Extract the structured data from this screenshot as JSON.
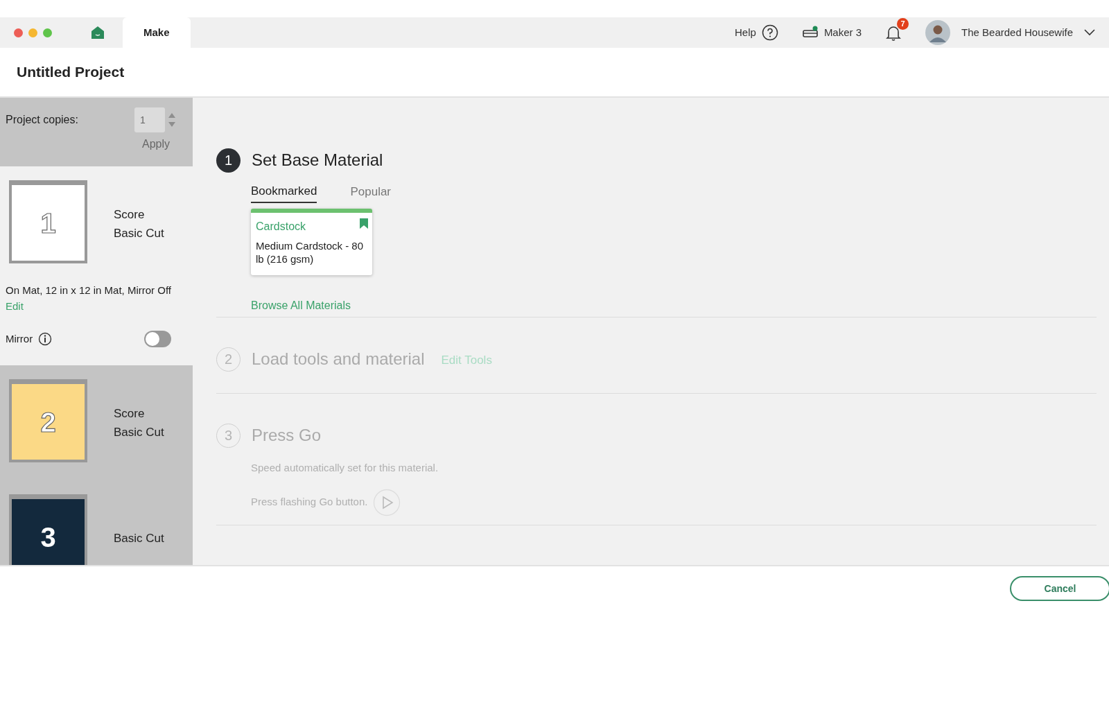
{
  "tabs": [
    {
      "kind": "home",
      "selected": false
    },
    {
      "kind": "text",
      "label": "Make",
      "selected": true
    }
  ],
  "top_bar": {
    "help": "Help",
    "machine": "Maker 3",
    "machine_connected": true,
    "notifications": "7",
    "user": "The Bearded Housewife"
  },
  "project": {
    "title": "Untitled Project"
  },
  "copies": {
    "label": "Project copies:",
    "value": "1",
    "button": "Apply",
    "disabled": true
  },
  "mats": [
    {
      "number": "1",
      "color": "#ffffff",
      "operations": [
        "Score",
        "Basic Cut"
      ],
      "selected": true
    },
    {
      "number": "2",
      "color": "#fbd986",
      "operations": [
        "Score",
        "Basic Cut"
      ],
      "selected": false
    },
    {
      "number": "3",
      "color": "#13293d",
      "operations": [
        "Basic Cut"
      ],
      "selected": false
    }
  ],
  "mat_settings": {
    "summary": "On Mat, 12 in x 12 in Mat, Mirror Off",
    "edit": "Edit",
    "mirror_label": "Mirror",
    "mirror_on": false
  },
  "steps": [
    {
      "kind": "material",
      "number": "1",
      "title": "Set Base Material",
      "active": true,
      "tabs": [
        {
          "label": "Bookmarked",
          "selected": true
        },
        {
          "label": "Popular",
          "selected": false
        }
      ],
      "material": {
        "category": "Cardstock",
        "name": "Medium Cardstock - 80 lb (216 gsm)",
        "bookmarked": true
      },
      "link": "Browse All Materials"
    },
    {
      "kind": "tools",
      "number": "2",
      "title": "Load tools and material",
      "active": false,
      "link": "Edit Tools"
    },
    {
      "kind": "go",
      "number": "3",
      "title": "Press Go",
      "active": false,
      "lines": [
        "Speed automatically set for this material.",
        "Press flashing Go button."
      ]
    }
  ],
  "footer": {
    "cancel": "Cancel"
  }
}
